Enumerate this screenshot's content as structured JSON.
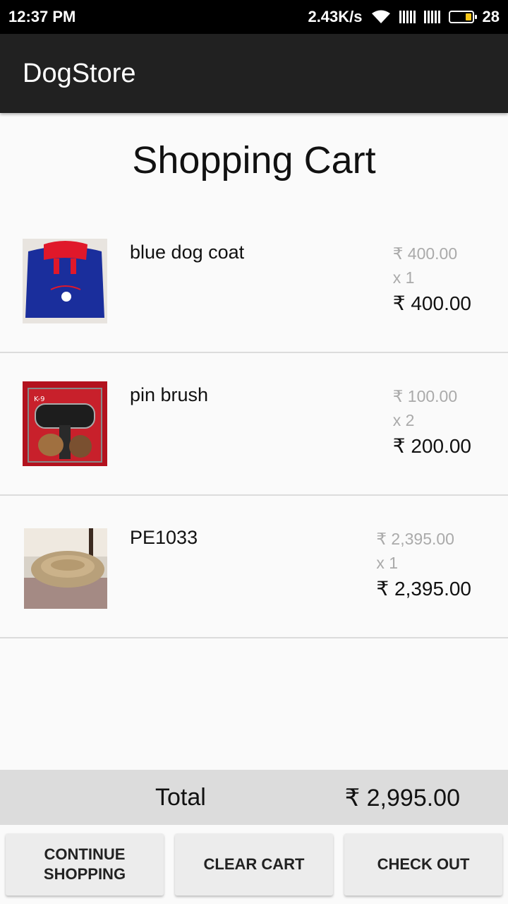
{
  "status_bar": {
    "time": "12:37 PM",
    "net_speed": "2.43K/s",
    "battery_level": "28",
    "icons": [
      "wifi-icon",
      "signal-icon",
      "battery-icon"
    ]
  },
  "app_bar": {
    "title": "DogStore"
  },
  "page": {
    "title": "Shopping Cart"
  },
  "cart": {
    "items": [
      {
        "name": "blue dog coat",
        "unit_price": "₹ 400.00",
        "qty": "x 1",
        "line_total": "₹ 400.00",
        "image": "blue-dog-coat-image"
      },
      {
        "name": "pin brush",
        "unit_price": "₹ 100.00",
        "qty": "x 2",
        "line_total": "₹ 200.00",
        "image": "pin-brush-image"
      },
      {
        "name": "PE1033",
        "unit_price": "₹ 2,395.00",
        "qty": "x 1",
        "line_total": "₹ 2,395.00",
        "image": "dog-bed-image"
      }
    ]
  },
  "total": {
    "label": "Total",
    "value": "₹ 2,995.00"
  },
  "buttons": {
    "continue_line1": "CONTINUE",
    "continue_line2": "SHOPPING",
    "clear": "CLEAR CART",
    "checkout": "CHECK OUT"
  },
  "colors": {
    "status_bar": "#000000",
    "app_bar": "#212121",
    "background": "#fafafa",
    "total_bar": "#dcdcdc",
    "muted_text": "#aaaaaa"
  }
}
